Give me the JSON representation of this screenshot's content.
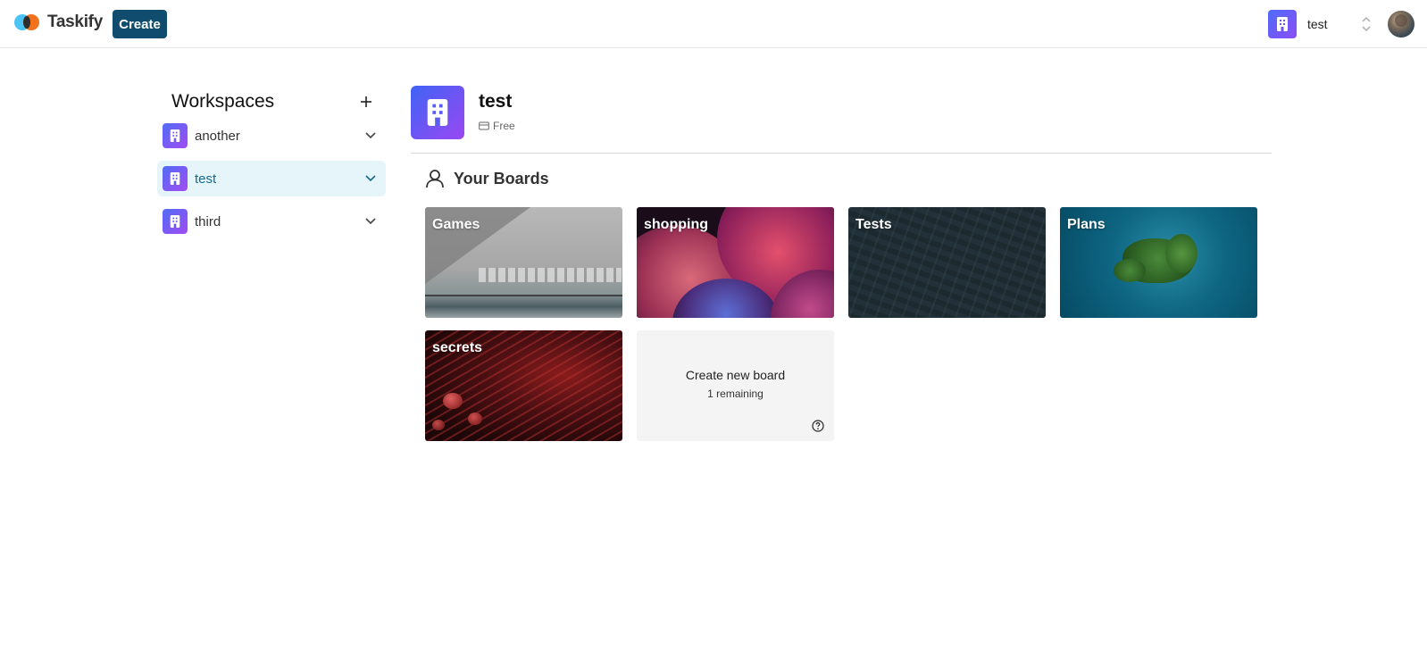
{
  "navbar": {
    "logo_text": "Taskify",
    "create_label": "Create",
    "org_name": "test"
  },
  "sidebar": {
    "title": "Workspaces",
    "items": [
      {
        "label": "another",
        "active": false
      },
      {
        "label": "test",
        "active": true
      },
      {
        "label": "third",
        "active": false
      }
    ]
  },
  "workspace": {
    "name": "test",
    "plan": "Free"
  },
  "boards": {
    "section_title": "Your Boards",
    "items": [
      {
        "title": "Games"
      },
      {
        "title": "shopping"
      },
      {
        "title": "Tests"
      },
      {
        "title": "Plans"
      },
      {
        "title": "secrets"
      }
    ],
    "create": {
      "label": "Create new board",
      "remaining": "1 remaining"
    }
  },
  "colors": {
    "brand_primary": "#0f4c6e",
    "workspace_gradient_start": "#4f6cf7",
    "workspace_gradient_end": "#9a48f2",
    "active_item_bg": "#e6f5fa"
  },
  "icons": [
    "building-icon",
    "plus-icon",
    "chevron-down-icon",
    "user-icon",
    "credit-card-icon",
    "help-circle-icon",
    "chevrons-up-down-icon"
  ]
}
